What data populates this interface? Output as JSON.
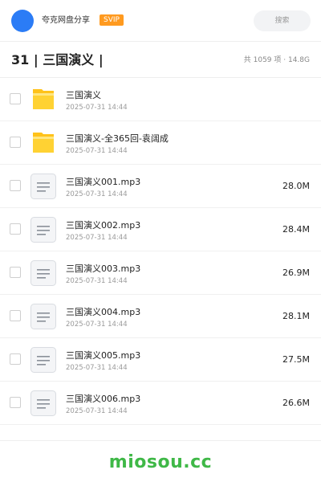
{
  "header": {
    "share_name": "夸克网盘分享",
    "badge": "SVIP",
    "search_placeholder": "搜索",
    "avatar_color": "#2b7cf6",
    "badge_color": "#ff9a1f"
  },
  "title_bar": {
    "folder_title": "31 | 三国演义 |",
    "summary": "共 1059 项 · 14.8G"
  },
  "files": [
    {
      "name": "三国演义",
      "date": "2025-07-31 14:44",
      "size": "",
      "icon": "folder-icon"
    },
    {
      "name": "三国演义-全365回-袁阔成",
      "date": "2025-07-31 14:44",
      "size": "",
      "icon": "folder-icon"
    },
    {
      "name": "三国演义001.mp3",
      "date": "2025-07-31 14:44",
      "size": "28.0M",
      "icon": "audio-file-icon"
    },
    {
      "name": "三国演义002.mp3",
      "date": "2025-07-31 14:44",
      "size": "28.4M",
      "icon": "audio-file-icon"
    },
    {
      "name": "三国演义003.mp3",
      "date": "2025-07-31 14:44",
      "size": "26.9M",
      "icon": "audio-file-icon"
    },
    {
      "name": "三国演义004.mp3",
      "date": "2025-07-31 14:44",
      "size": "28.1M",
      "icon": "audio-file-icon"
    },
    {
      "name": "三国演义005.mp3",
      "date": "2025-07-31 14:44",
      "size": "27.5M",
      "icon": "audio-file-icon"
    },
    {
      "name": "三国演义006.mp3",
      "date": "2025-07-31 14:44",
      "size": "26.6M",
      "icon": "audio-file-icon"
    }
  ],
  "footer": {
    "watermark": "miosou.cc",
    "watermark_color": "#3fb847"
  }
}
